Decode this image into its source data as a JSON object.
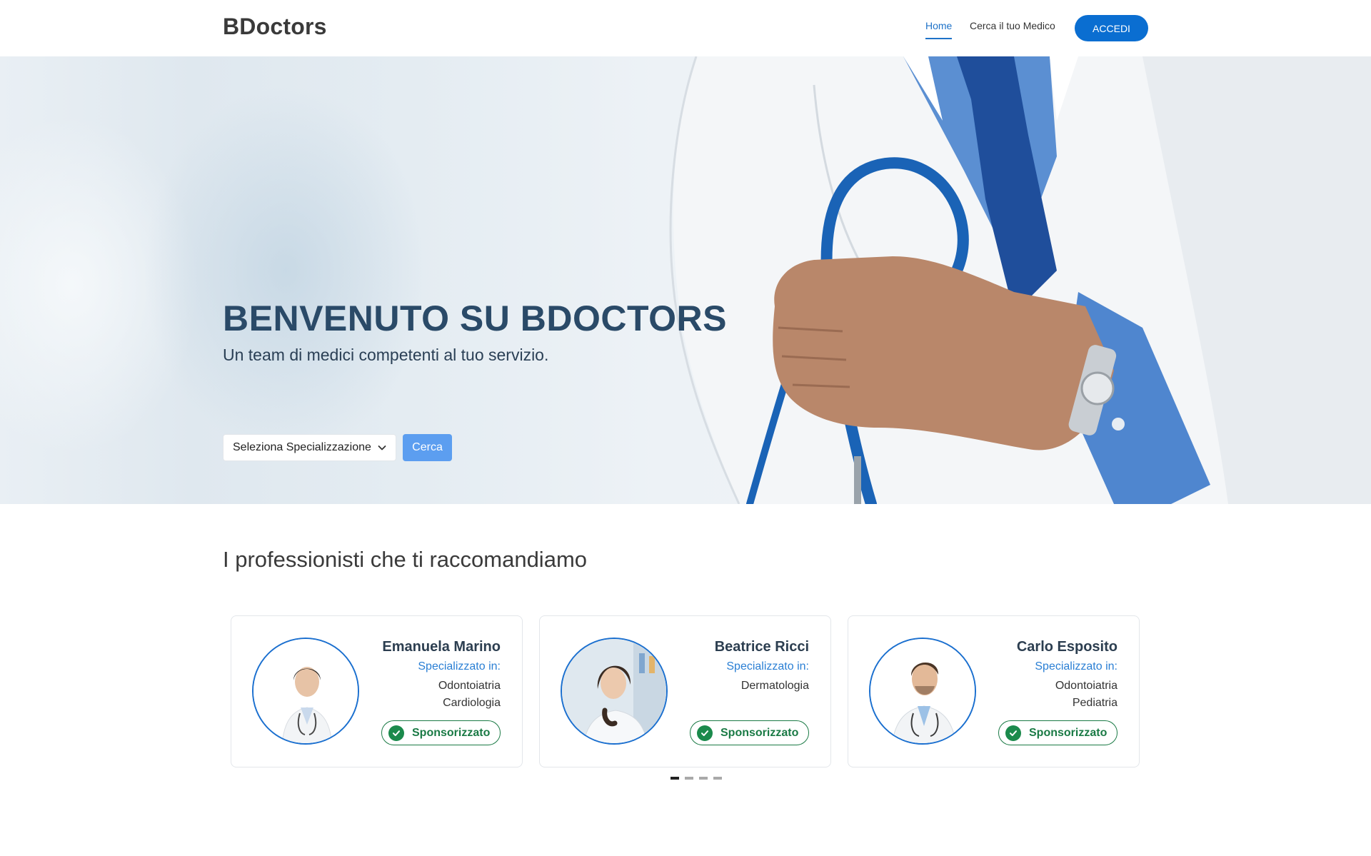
{
  "navbar": {
    "brand": "BDoctors",
    "links": [
      {
        "label": "Home",
        "active": true
      },
      {
        "label": "Cerca il tuo Medico",
        "active": false
      }
    ],
    "login_label": "ACCEDI"
  },
  "hero": {
    "title": "BENVENUTO SU BDOCTORS",
    "subtitle": "Un team di medici competenti al tuo servizio.",
    "select_value": "Seleziona Specializzazione",
    "search_label": "Cerca"
  },
  "recommended": {
    "title": "I professionisti che ti raccomandiamo",
    "cards": [
      {
        "name": "Emanuela Marino",
        "spec_label": "Specializzato in:",
        "specs": [
          "Odontoiatria",
          "Cardiologia"
        ],
        "badge": "Sponsorizzato"
      },
      {
        "name": "Beatrice Ricci",
        "spec_label": "Specializzato in:",
        "specs": [
          "Dermatologia"
        ],
        "badge": "Sponsorizzato"
      },
      {
        "name": "Carlo Esposito",
        "spec_label": "Specializzato in:",
        "specs": [
          "Odontoiatria",
          "Pediatria"
        ],
        "badge": "Sponsorizzato"
      }
    ],
    "carousel": {
      "pages": 4,
      "active": 1
    }
  },
  "colors": {
    "primary": "#0a6ed1",
    "accent_link": "#1e72c8",
    "search_button": "#5c9ef0",
    "sponsored": "#1a7a45"
  },
  "icons": {
    "select_chevron": "chevron-down-icon",
    "badge": "check-circle-icon"
  }
}
